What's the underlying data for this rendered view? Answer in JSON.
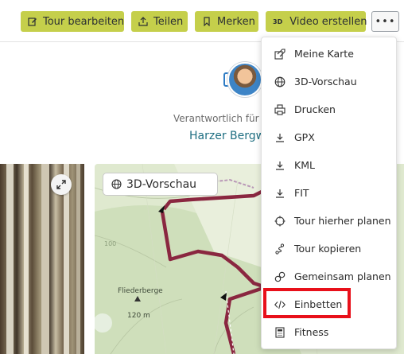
{
  "toolbar": {
    "buttons": [
      {
        "label": "Tour bearbeiten",
        "icon": "edit-icon"
      },
      {
        "label": "Teilen",
        "icon": "share-icon"
      },
      {
        "label": "Merken",
        "icon": "bookmark-icon"
      },
      {
        "label": "Video erstellen",
        "icon_text": "3D"
      }
    ],
    "more_label": "•••"
  },
  "author": {
    "responsible_label": "Verantwortlich für",
    "name": "Harzer Bergw"
  },
  "map": {
    "preview_button": "3D-Vorschau",
    "peak_name": "Fliederberge",
    "peak_elevation": "120 m",
    "contour_label": "100"
  },
  "menu": {
    "items": [
      {
        "label": "Meine Karte",
        "icon": "my-map-icon"
      },
      {
        "label": "3D-Vorschau",
        "icon": "globe-icon"
      },
      {
        "label": "Drucken",
        "icon": "printer-icon"
      },
      {
        "label": "GPX",
        "icon": "download-icon"
      },
      {
        "label": "KML",
        "icon": "download-icon"
      },
      {
        "label": "FIT",
        "icon": "download-icon"
      },
      {
        "label": "Tour hierher planen",
        "icon": "crosshair-icon"
      },
      {
        "label": "Tour kopieren",
        "icon": "route-icon"
      },
      {
        "label": "Gemeinsam planen",
        "icon": "link-icon"
      },
      {
        "label": "Einbetten",
        "icon": "embed-code-icon"
      },
      {
        "label": "Fitness",
        "icon": "calculator-icon"
      }
    ]
  },
  "colors": {
    "accent_button": "#c5cf4b",
    "link": "#1f6f82",
    "highlight": "#e8101a",
    "route": "#8a2740"
  }
}
